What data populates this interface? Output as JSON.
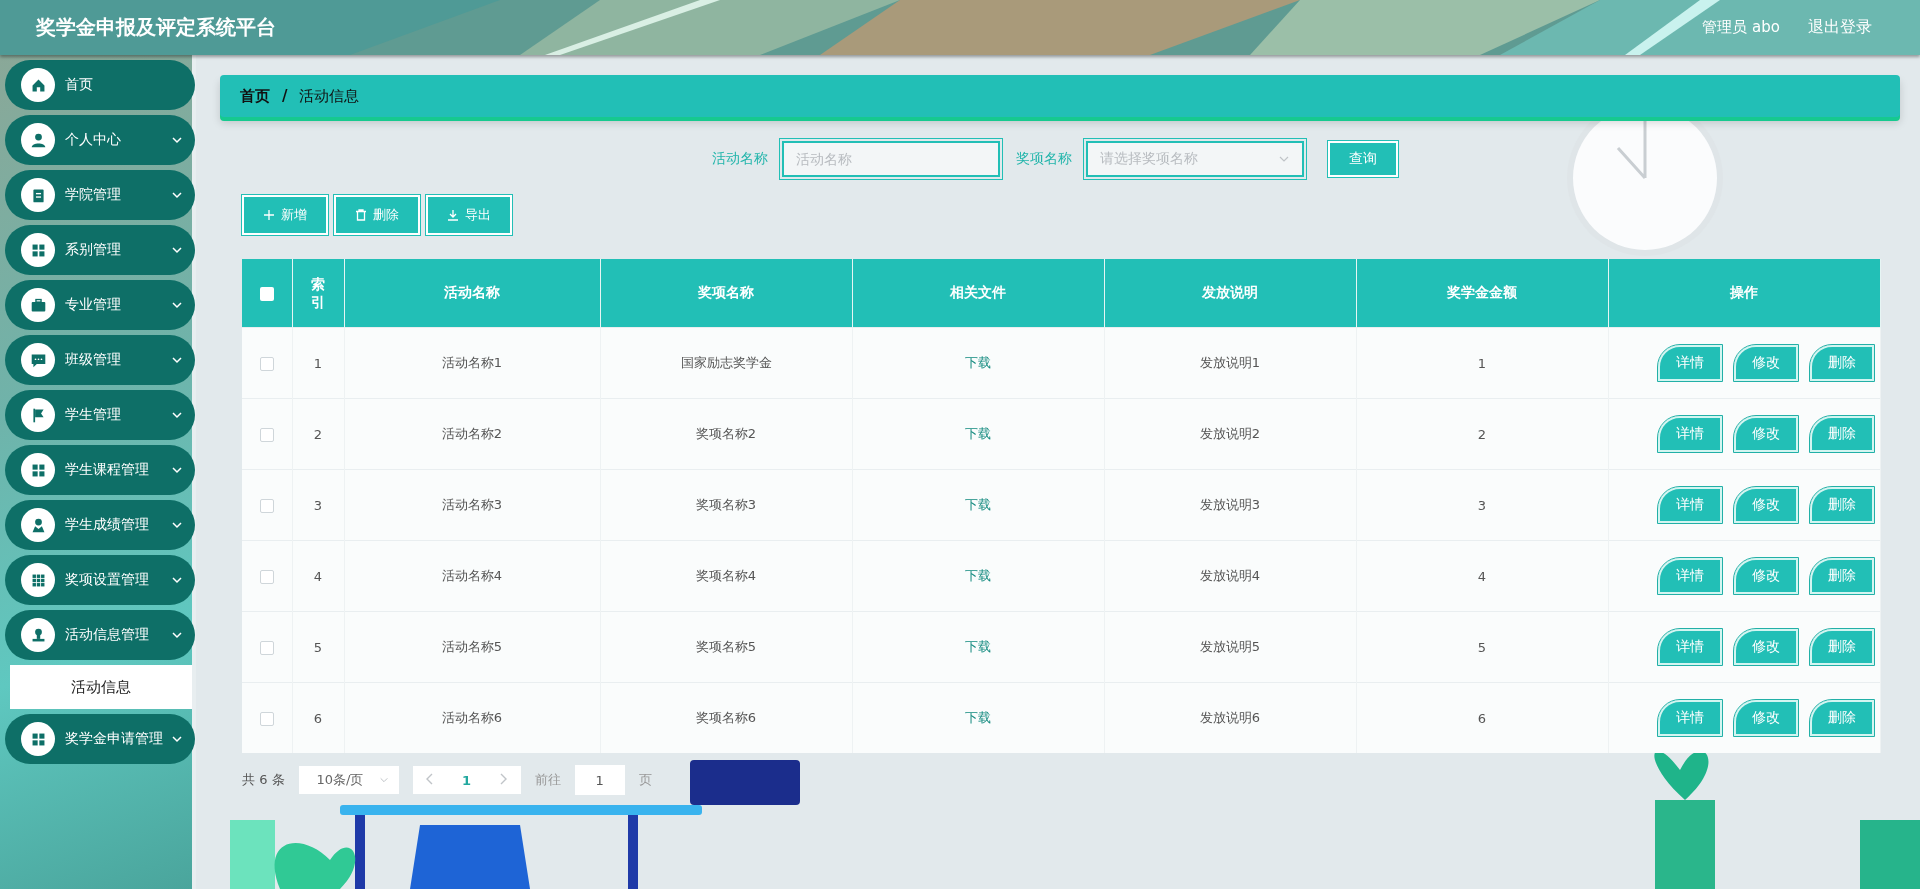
{
  "header": {
    "title": "奖学金申报及评定系统平台",
    "user": "管理员 abo",
    "logout": "退出登录"
  },
  "sidebar": {
    "items": [
      {
        "kind": "link",
        "label": "首页"
      },
      {
        "kind": "group",
        "label": "个人中心"
      },
      {
        "kind": "group",
        "label": "学院管理"
      },
      {
        "kind": "group",
        "label": "系别管理"
      },
      {
        "kind": "group",
        "label": "专业管理"
      },
      {
        "kind": "group",
        "label": "班级管理"
      },
      {
        "kind": "group",
        "label": "学生管理"
      },
      {
        "kind": "group",
        "label": "学生课程管理"
      },
      {
        "kind": "group",
        "label": "学生成绩管理"
      },
      {
        "kind": "group",
        "label": "奖项设置管理"
      },
      {
        "kind": "group",
        "label": "活动信息管理",
        "children": [
          {
            "label": "活动信息",
            "selected": true
          }
        ]
      },
      {
        "kind": "group",
        "label": "奖学金申请管理"
      }
    ]
  },
  "breadcrumb": {
    "items": [
      "首页",
      "活动信息"
    ],
    "separator": "/"
  },
  "search": {
    "fields": [
      {
        "kind": "input",
        "label": "活动名称",
        "placeholder": "活动名称"
      },
      {
        "kind": "select",
        "label": "奖项名称",
        "placeholder": "请选择奖项名称"
      }
    ],
    "button": "查询"
  },
  "toolbar": [
    {
      "kind": "add",
      "label": "新增"
    },
    {
      "kind": "delete",
      "label": "删除"
    },
    {
      "kind": "export",
      "label": "导出"
    }
  ],
  "table": {
    "all_checked": false,
    "columns": [
      "索引",
      "活动名称",
      "奖项名称",
      "相关文件",
      "发放说明",
      "奖学金金额",
      "操作"
    ],
    "rows": [
      {
        "checked": false,
        "index": "1",
        "name": "活动名称1",
        "award": "国家励志奖学金",
        "file": "下载",
        "note": "发放说明1",
        "amount": "1",
        "actions": [
          "详情",
          "修改",
          "删除"
        ]
      },
      {
        "checked": false,
        "index": "2",
        "name": "活动名称2",
        "award": "奖项名称2",
        "file": "下载",
        "note": "发放说明2",
        "amount": "2",
        "actions": [
          "详情",
          "修改",
          "删除"
        ]
      },
      {
        "checked": false,
        "index": "3",
        "name": "活动名称3",
        "award": "奖项名称3",
        "file": "下载",
        "note": "发放说明3",
        "amount": "3",
        "actions": [
          "详情",
          "修改",
          "删除"
        ]
      },
      {
        "checked": false,
        "index": "4",
        "name": "活动名称4",
        "award": "奖项名称4",
        "file": "下载",
        "note": "发放说明4",
        "amount": "4",
        "actions": [
          "详情",
          "修改",
          "删除"
        ]
      },
      {
        "checked": false,
        "index": "5",
        "name": "活动名称5",
        "award": "奖项名称5",
        "file": "下载",
        "note": "发放说明5",
        "amount": "5",
        "actions": [
          "详情",
          "修改",
          "删除"
        ]
      },
      {
        "checked": false,
        "index": "6",
        "name": "活动名称6",
        "award": "奖项名称6",
        "file": "下载",
        "note": "发放说明6",
        "amount": "6",
        "actions": [
          "详情",
          "修改",
          "删除"
        ]
      }
    ]
  },
  "pagination": {
    "total": "共 6 条",
    "page_size": "10条/页",
    "pages": [
      {
        "label": "1",
        "selected": true
      }
    ],
    "goto_label": "前往",
    "goto_value": "1",
    "goto_suffix": "页"
  }
}
